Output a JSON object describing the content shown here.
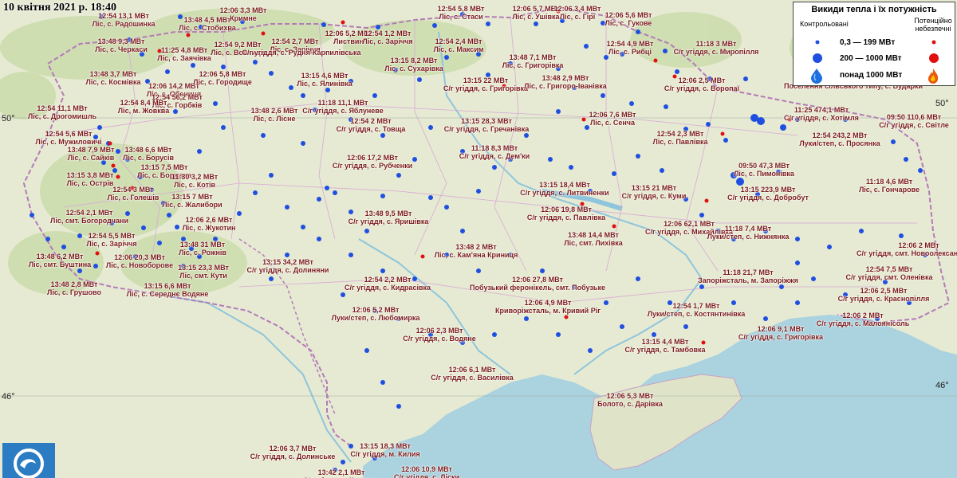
{
  "header": {
    "timestamp": "10 квітня 2021 р. 18:40"
  },
  "coords": {
    "lat50_left": "50°",
    "lat50_right": "50°",
    "lat46_left": "46°",
    "lat46_right": "46°"
  },
  "legend": {
    "title": "Викиди тепла і їх потужність",
    "controlled": "Контрольовані",
    "dangerous": "Потенційно небезпечні",
    "small": "0,3 — 199 МВт",
    "medium": "200 — 1000 МВт",
    "large": "понад 1000 МВт"
  },
  "colors": {
    "controlled": "#1f4fe0",
    "dangerous": "#e01010",
    "label": "#7a1a1a"
  },
  "icons": {
    "large_controlled": "water-drop-icon",
    "large_dangerous": "flame-icon",
    "logo": "wave-logo-icon"
  },
  "fires": [
    {
      "time": "12:54",
      "power": "13,1 МВт",
      "place": "Ліс, с. Радошинка"
    },
    {
      "time": "13:48",
      "power": "4,5 МВт",
      "place": "Ліс, с. Стобихва"
    },
    {
      "time": "12:06",
      "power": "3,3 МВт",
      "place": "Кримне"
    },
    {
      "time": "12:54",
      "power": "5,8 МВт",
      "place": "Ліс, с. Стаси"
    },
    {
      "time": "12:06",
      "power": "5,7 МВт",
      "place": "Ліс, с. Ушівка"
    },
    {
      "time": "12:06",
      "power": "3,4 МВт",
      "place": "Ліс, с. Гірі"
    },
    {
      "time": "12:06",
      "power": "5,6 МВт",
      "place": "Ліс, с. Гукове"
    },
    {
      "time": "13:48",
      "power": "9,3 МВт",
      "place": "Ліс, с. Черкаси"
    },
    {
      "time": "11:25",
      "power": "4,8 МВт",
      "place": "Ліс, с. Заячівка"
    },
    {
      "time": "12:54",
      "power": "9,2 МВт",
      "place": "Ліс, с. Вовчиця"
    },
    {
      "time": "12:54",
      "power": "2,7 МВт",
      "place": "Ліс, с. Заріччя"
    },
    {
      "time": "12:06",
      "power": "5,2 МВт",
      "place": "Листвин"
    },
    {
      "time": "12:54",
      "power": "1,2 МВт",
      "place": "Ліс, с. Заріччя"
    },
    {
      "time": "12:54",
      "power": "2,4 МВт",
      "place": "Ліс, с. Максим"
    },
    {
      "time": "12:54",
      "power": "4,9 МВт",
      "place": "Ліс, с. Рибці"
    },
    {
      "time": "11:18",
      "power": "3 МВт",
      "place": "С/г угіддя, с. Миропілля"
    },
    {
      "time": "13:48",
      "power": "3,7 МВт",
      "place": "Ліс, с. Космівка"
    },
    {
      "time": "12:06",
      "power": "14,2 МВт",
      "place": "Ліс, с. Обениця"
    },
    {
      "time": "12:06",
      "power": "5,8 МВт",
      "place": "Ліс, с. Городище"
    },
    {
      "time": "",
      "power": "",
      "place": "С/г угіддя, с. Рудня-Карпилівська"
    },
    {
      "time": "13:15",
      "power": "4,6 МВт",
      "place": "Ліс, с. Ялинівка"
    },
    {
      "time": "13:15",
      "power": "8,2 МВт",
      "place": "Ліс, с. Сухарівка"
    },
    {
      "time": "13:48",
      "power": "7,1 МВт",
      "place": "Ліс, с. Григорівка"
    },
    {
      "time": "13:15",
      "power": "22 МВт",
      "place": "С/г угіддя, с. Григорівка"
    },
    {
      "time": "13:48",
      "power": "2,9 МВт",
      "place": "Ліс, с. Григоро-Іванівка"
    },
    {
      "time": "12:06",
      "power": "2,5 МВт",
      "place": "С/г угіддя, с. Воропаї"
    },
    {
      "time": "12:54",
      "power": "56,2 МВт",
      "place": "Ліс, с. Горбків"
    },
    {
      "time": "11:18",
      "power": "11,1 МВт",
      "place": "С/г угіддя, с. Яблуневе"
    },
    {
      "time": "",
      "power": "",
      "place": "Поселення сільського типу, с. Бударки"
    },
    {
      "time": "12:54",
      "power": "11,1 МВт",
      "place": "Ліс, с. Дрогомишль"
    },
    {
      "time": "12:54",
      "power": "8,4 МВт",
      "place": "Ліс, м. Жовква"
    },
    {
      "time": "13:48",
      "power": "2,6 МВт",
      "place": "Ліс, с. Лісне"
    },
    {
      "time": "12:54",
      "power": "2 МВт",
      "place": "С/г угіддя, с. Товща"
    },
    {
      "time": "13:15",
      "power": "28,3 МВт",
      "place": "С/г угіддя, с. Гречанівка"
    },
    {
      "time": "12:06",
      "power": "7,6 МВт",
      "place": "Ліс, с. Сенча"
    },
    {
      "time": "11:25",
      "power": "474,1 МВт",
      "place": "С/г угіддя, с. Хотімля"
    },
    {
      "time": "09:50",
      "power": "110,6 МВт",
      "place": "С/г угіддя, с. Світле"
    },
    {
      "time": "12:54",
      "power": "5,6 МВт",
      "place": "Ліс, с. Мужиловичі"
    },
    {
      "time": "13:48",
      "power": "6,6 МВт",
      "place": "Ліс, с. Борусів"
    },
    {
      "time": "11:18",
      "power": "8,3 МВт",
      "place": "С/г угіддя, с. Дем'ки"
    },
    {
      "time": "12:54",
      "power": "2,3 МВт",
      "place": "Ліс, с. Павлівка"
    },
    {
      "time": "12:54",
      "power": "243,2 МВт",
      "place": "Луки/степ, с. Просянка"
    },
    {
      "time": "13:48",
      "power": "7,9 МВт",
      "place": "Ліс, с. Сайків"
    },
    {
      "time": "13:15",
      "power": "7,5 МВт",
      "place": "Ліс, с. Боржава"
    },
    {
      "time": "12:06",
      "power": "17,2 МВт",
      "place": "С/г угіддя, с. Рубченки"
    },
    {
      "time": "09:50",
      "power": "47,3 МВт",
      "place": "Ліс, с. Пимонівка"
    },
    {
      "time": "13:15",
      "power": "3,8 МВт",
      "place": "Ліс, с. Острів"
    },
    {
      "time": "11:30",
      "power": "3,2 МВт",
      "place": "Ліс, с. Котів"
    },
    {
      "time": "11:18",
      "power": "4,6 МВт",
      "place": "Ліс, с. Гончарове"
    },
    {
      "time": "12:54",
      "power": "3 МВт",
      "place": "Ліс, с. Голешів"
    },
    {
      "time": "13:15",
      "power": "7 МВт",
      "place": "Ліс, с. Жалибори"
    },
    {
      "time": "13:15",
      "power": "18,4 МВт",
      "place": "С/г угіддя, с. Литвиненки"
    },
    {
      "time": "13:15",
      "power": "21 МВт",
      "place": "С/г угіддя, с. Куми"
    },
    {
      "time": "13:15",
      "power": "223,9 МВт",
      "place": "С/г угіддя, с. Добробут"
    },
    {
      "time": "12:54",
      "power": "2,1 МВт",
      "place": "Ліс, смт. Богородчани"
    },
    {
      "time": "12:06",
      "power": "2,6 МВт",
      "place": "Ліс, с. Жукотин"
    },
    {
      "time": "12:06",
      "power": "19,8 МВт",
      "place": "С/г угіддя, с. Павлівка"
    },
    {
      "time": "12:06",
      "power": "62,1 МВт",
      "place": "С/г угіддя, с. Михайлівка"
    },
    {
      "time": "13:48",
      "power": "9,5 МВт",
      "place": "С/г угіддя, с. Яришівка"
    },
    {
      "time": "11:18",
      "power": "7,4 МВт",
      "place": "Луки/степ, с. Нижнянка"
    },
    {
      "time": "12:54",
      "power": "5,5 МВт",
      "place": "Ліс, с. Заріччя"
    },
    {
      "time": "13:48",
      "power": "31 МВт",
      "place": "Ліс, с. Рожнів"
    },
    {
      "time": "13:48",
      "power": "14,4 МВт",
      "place": "Ліс, смт. Лихівка"
    },
    {
      "time": "12:06",
      "power": "2 МВт",
      "place": "С/г угіддя, смт. Новоолександрівка"
    },
    {
      "time": "13:48",
      "power": "6,2 МВт",
      "place": "Ліс, смт. Буштина"
    },
    {
      "time": "12:06",
      "power": "20,3 МВт",
      "place": "Ліс, с. Новоборове"
    },
    {
      "time": "13:15",
      "power": "34,2 МВт",
      "place": "С/г угіддя, с. Долиняни"
    },
    {
      "time": "13:48",
      "power": "2 МВт",
      "place": "Ліс, с. Кам'яна Криниця"
    },
    {
      "time": "13:15",
      "power": "23,3 МВт",
      "place": "Ліс, смт. Кути"
    },
    {
      "time": "12:54",
      "power": "7,5 МВт",
      "place": "С/г угіддя, смт. Оленівка"
    },
    {
      "time": "13:48",
      "power": "2,8 МВт",
      "place": "Ліс, с. Грушово"
    },
    {
      "time": "13:15",
      "power": "6,6 МВт",
      "place": "Ліс, с. Середнє Водяне"
    },
    {
      "time": "12:54",
      "power": "2,2 МВт",
      "place": "С/г угіддя, с. Кидрасівка"
    },
    {
      "time": "12:06",
      "power": "27,8 МВт",
      "place": "Побузький феронікель, смт. Побузьке"
    },
    {
      "time": "11:18",
      "power": "21,7 МВт",
      "place": "Запоріжсталь, м. Запоріжжя"
    },
    {
      "time": "12:06",
      "power": "2,5 МВт",
      "place": "С/г угіддя, с. Краснопілля"
    },
    {
      "time": "12:06",
      "power": "5,2 МВт",
      "place": "Луки/степ, с. Любомирка"
    },
    {
      "time": "12:06",
      "power": "4,9 МВт",
      "place": "Криворіжсталь, м. Кривий Ріг"
    },
    {
      "time": "12:54",
      "power": "1,7 МВт",
      "place": "Луки/степ, с. Костянтинівка"
    },
    {
      "time": "12:06",
      "power": "2 МВт",
      "place": "С/г угіддя, с. Малоянісоль"
    },
    {
      "time": "12:06",
      "power": "2,3 МВт",
      "place": "С/г угіддя, с. Водяне"
    },
    {
      "time": "12:06",
      "power": "9,1 МВт",
      "place": "С/г угіддя, с. Григорівка"
    },
    {
      "time": "13:15",
      "power": "4,4 МВт",
      "place": "С/г угіддя, с. Тамбовка"
    },
    {
      "time": "12:06",
      "power": "6,1 МВт",
      "place": "С/г угіддя, с. Василівка"
    },
    {
      "time": "12:06",
      "power": "5,3 МВт",
      "place": "Болото, с. Дарівка"
    },
    {
      "time": "12:06",
      "power": "3,7 МВт",
      "place": "С/г угіддя, с. Долинське"
    },
    {
      "time": "13:15",
      "power": "18,3 МВт",
      "place": "С/г угіддя, м. Килия"
    },
    {
      "time": "13:42",
      "power": "2,1 МВт",
      "place": "С/г угіддя, с. Кислиця"
    },
    {
      "time": "12:06",
      "power": "10,9 МВт",
      "place": "С/г угіддя, с. Ліски"
    }
  ]
}
